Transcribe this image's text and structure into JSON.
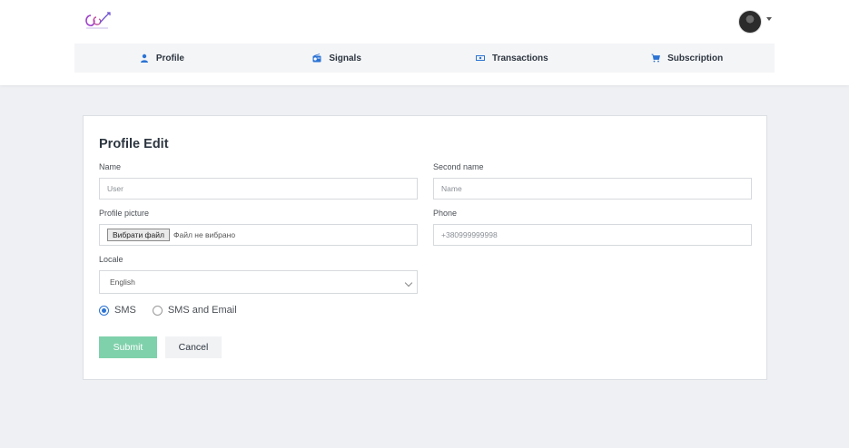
{
  "header": {
    "logo_icon": "brand-logo-icon",
    "avatar_icon": "user-avatar",
    "tabs": [
      {
        "label": "Profile",
        "icon": "person-icon"
      },
      {
        "label": "Signals",
        "icon": "radio-icon"
      },
      {
        "label": "Transactions",
        "icon": "money-icon"
      },
      {
        "label": "Subscription",
        "icon": "cart-icon"
      }
    ]
  },
  "form": {
    "title": "Profile Edit",
    "name_label": "Name",
    "name_placeholder": "User",
    "second_name_label": "Second name",
    "second_name_placeholder": "Name",
    "picture_label": "Profile picture",
    "file_button": "Вибрати файл",
    "file_status": "Файл не вибрано",
    "phone_label": "Phone",
    "phone_placeholder": "+380999999998",
    "locale_label": "Locale",
    "locale_value": "English",
    "radio_options": [
      {
        "label": "SMS",
        "checked": true
      },
      {
        "label": "SMS and Email",
        "checked": false
      }
    ],
    "submit_label": "Submit",
    "cancel_label": "Cancel"
  },
  "colors": {
    "accent_submit": "#7fd1ab",
    "radio_checked": "#2b73d4",
    "logo_primary": "#9b3fc9"
  }
}
